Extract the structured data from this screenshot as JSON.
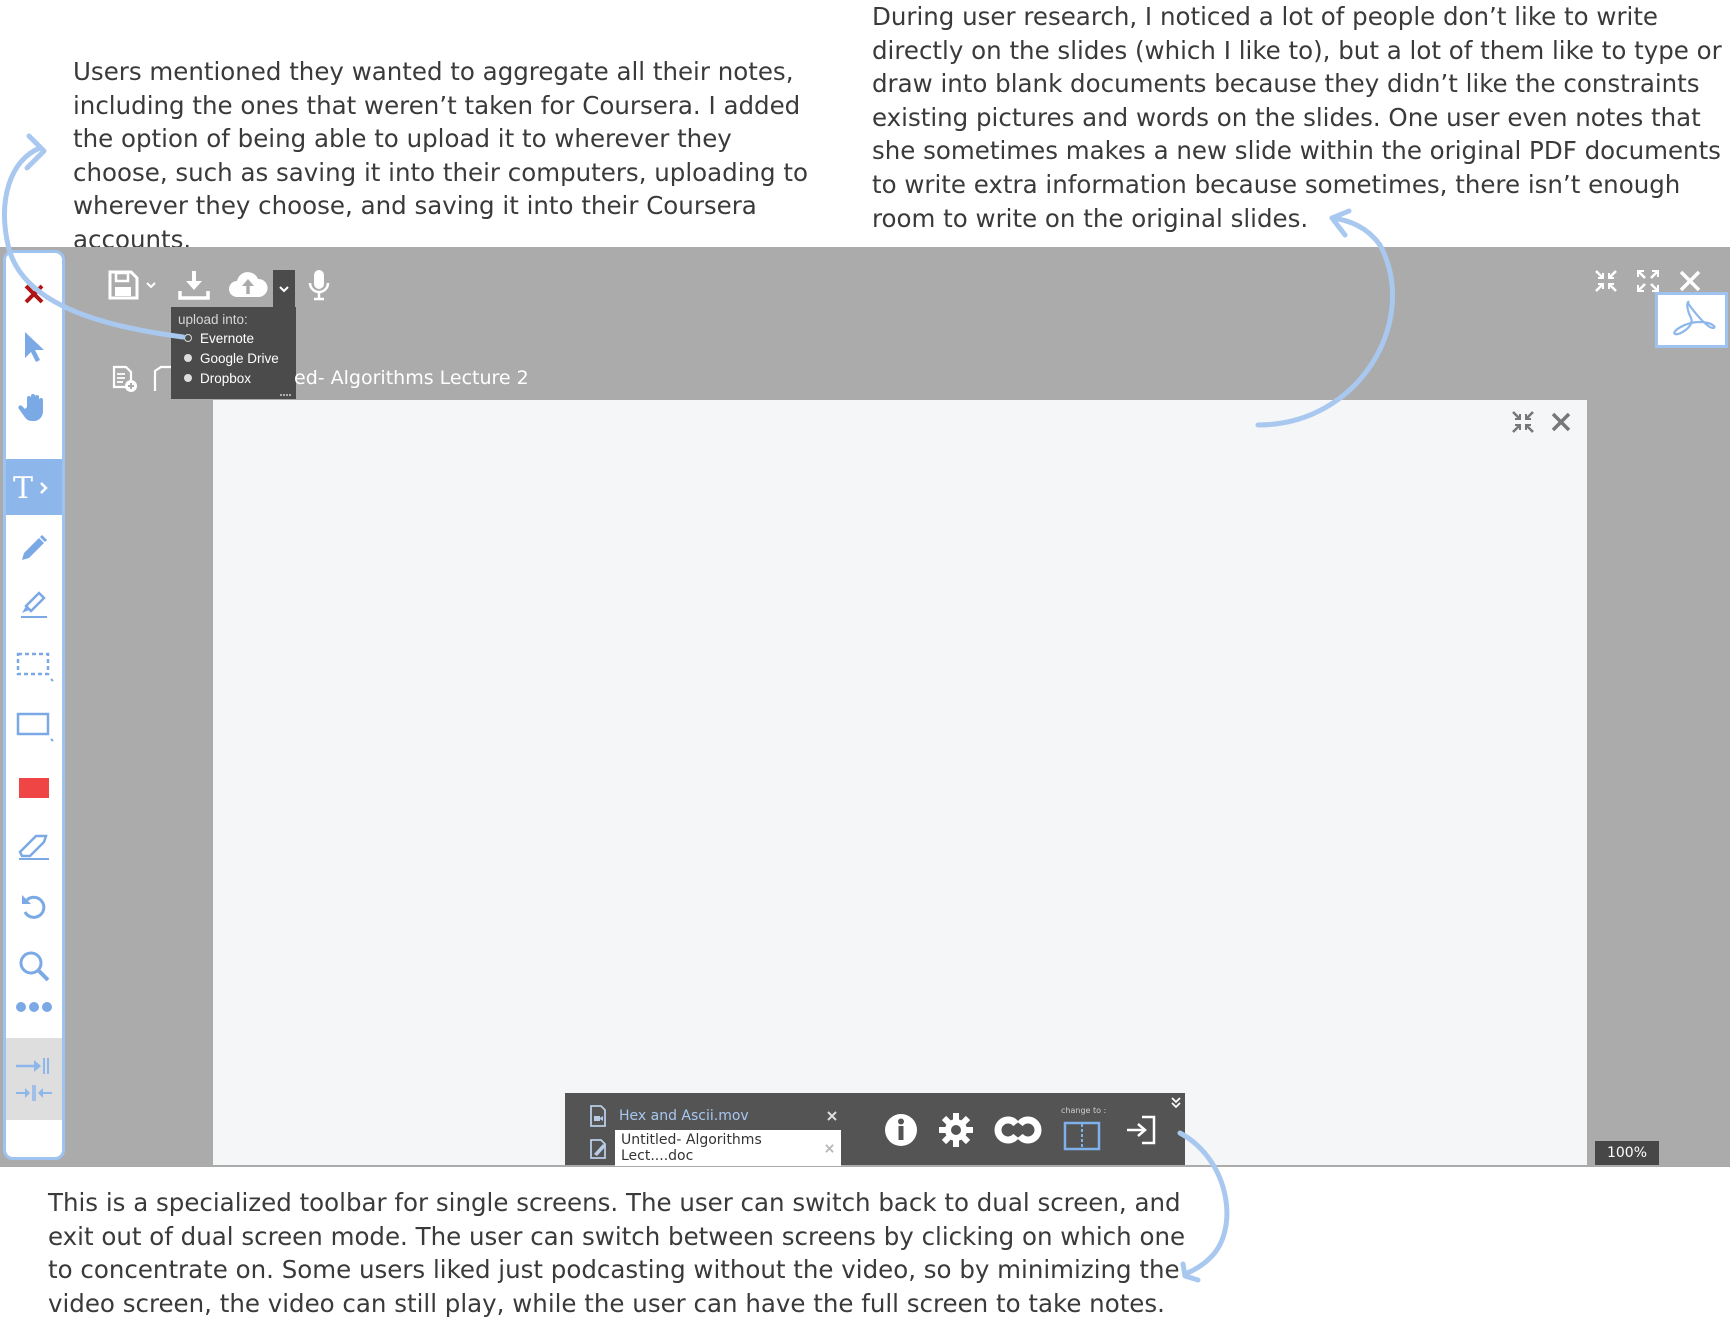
{
  "annotations": {
    "left": "Users mentioned they wanted to aggregate all their notes, including the ones that weren’t taken for Coursera.  I added the option of being able to upload it to wherever they choose, such as saving it into their computers, uploading to wherever they choose, and saving it into their Coursera accounts.",
    "right": "During user research, I noticed a lot of people don’t like to write directly on the slides (which I like to), but a lot of them like to type or draw into blank documents because they didn’t like the constraints existing pictures and words on the slides.  One user even notes that she sometimes makes a new slide within the original PDF documents to write extra information because sometimes, there isn’t enough room to write on the original slides.",
    "bottom": "This is a specialized toolbar for single screens.  The user can switch back to dual screen, and exit out of dual screen mode.  The user can switch between screens by clicking on which one to concentrate on.  Some users liked just podcasting without the video, so by minimizing the video screen, the video can still play, while the user can have the full screen to take notes."
  },
  "upload_menu": {
    "header": "upload into:",
    "options": [
      "Evernote",
      "Google Drive",
      "Dropbox"
    ]
  },
  "document": {
    "title_visible": "ed- Algorithms Lecture 2"
  },
  "sidebar_tools": [
    "close-icon",
    "pointer-icon",
    "hand-icon",
    "text-icon",
    "pencil-icon",
    "highlighter-icon",
    "selection-icon",
    "rectangle-icon",
    "color-swatch-icon",
    "eraser-icon",
    "undo-icon",
    "zoom-icon",
    "more-icon",
    "expand-icon",
    "collapse-icon"
  ],
  "bottom_bar": {
    "file1": "Hex and Ascii.mov",
    "file2": "Untitled- Algorithms Lect....doc",
    "change_to": "change to :"
  },
  "zoom": "100%",
  "colors": {
    "accent": "#9fc3ef",
    "close_red": "#b01515",
    "swatch_red": "#f04545",
    "frame_gray": "#ababab"
  }
}
